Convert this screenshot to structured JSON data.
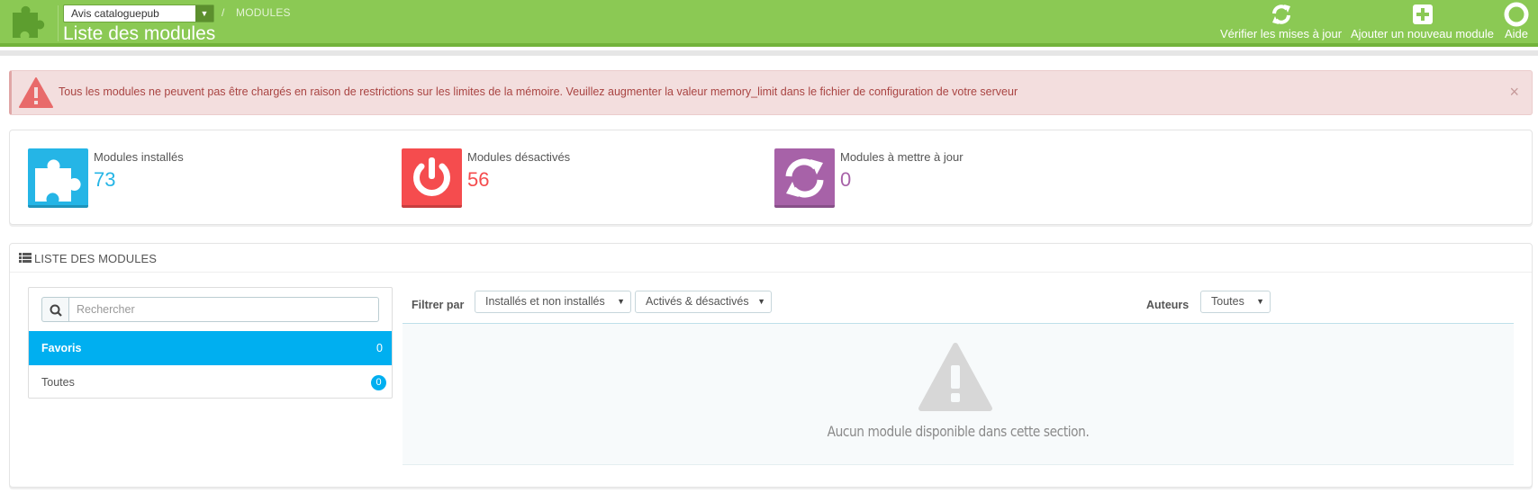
{
  "header": {
    "shop_select": "Avis cataloguepub",
    "breadcrumb": "MODULES",
    "breadcrumb_separator": "/",
    "title": "Liste des modules",
    "toolbar": {
      "check_updates": "Vérifier les mises à jour",
      "add_module": "Ajouter un nouveau module",
      "help": "Aide"
    }
  },
  "alert": {
    "message": "Tous les modules ne peuvent pas être chargés en raison de restrictions sur les limites de la mémoire. Veuillez augmenter la valeur memory_limit dans le fichier de configuration de votre serveur",
    "close": "×"
  },
  "kpis": {
    "installed": {
      "label": "Modules installés",
      "value": "73",
      "color": "#25b5e6",
      "icon": "puzzle-icon"
    },
    "disabled": {
      "label": "Modules désactivés",
      "value": "56",
      "color": "#f54c4e",
      "icon": "power-icon"
    },
    "to_update": {
      "label": "Modules à mettre à jour",
      "value": "0",
      "color": "#a762a8",
      "icon": "refresh-icon"
    }
  },
  "module_list": {
    "panel_title": "LISTE DES MODULES",
    "search_placeholder": "Rechercher",
    "categories": [
      {
        "label": "Favoris",
        "count": "0",
        "active": true
      },
      {
        "label": "Toutes",
        "count": "0",
        "active": false
      }
    ],
    "filter_label": "Filtrer par",
    "filter_install": "Installés et non installés",
    "filter_status": "Activés & désactivés",
    "authors_label": "Auteurs",
    "authors_value": "Toutes",
    "empty_message": "Aucun module disponible dans cette section."
  },
  "colors": {
    "header_green": "#8bc954",
    "accent_blue": "#00aff0",
    "alert_red": "#a94442"
  }
}
